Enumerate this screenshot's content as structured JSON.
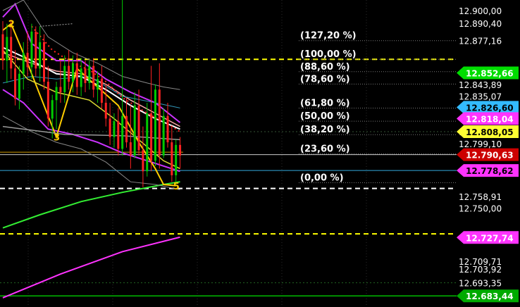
{
  "chart_data": {
    "type": "line",
    "title": "",
    "xlabel": "",
    "ylabel": "",
    "ylim": [
      12675.0,
      12908.0
    ],
    "axis_ticks": [
      {
        "label": "12.900,00",
        "value": 12900.0
      },
      {
        "label": "12.890,40",
        "value": 12890.4
      },
      {
        "label": "12.877,16",
        "value": 12877.16
      },
      {
        "label": "12.843,89",
        "value": 12843.89
      },
      {
        "label": "12.835,07",
        "value": 12835.07
      },
      {
        "label": "12.808,05",
        "value": 12808.05
      },
      {
        "label": "12.799,10",
        "value": 12799.1
      },
      {
        "label": "12.758,91",
        "value": 12758.91
      },
      {
        "label": "12.750,00",
        "value": 12750.0
      },
      {
        "label": "12.709,71",
        "value": 12709.71
      },
      {
        "label": "12.703,92",
        "value": 12703.92
      },
      {
        "label": "12.693,35",
        "value": 12693.35
      }
    ],
    "price_tags": [
      {
        "label": "12.852,66",
        "value": 12852.66,
        "bg": "#00dd00",
        "fg": "#ffffff"
      },
      {
        "label": "12.826,60",
        "value": 12826.6,
        "bg": "#33bbff",
        "fg": "#000000"
      },
      {
        "label": "12.818,04",
        "value": 12818.04,
        "bg": "#ff33ff",
        "fg": "#ffffff"
      },
      {
        "label": "12.808,05",
        "value": 12808.05,
        "bg": "#ffff33",
        "fg": "#000000"
      },
      {
        "label": "12.790,63",
        "value": 12790.63,
        "bg": "#cc0000",
        "fg": "#ffffff"
      },
      {
        "label": "12.778,62",
        "value": 12778.62,
        "bg": "#ff33ff",
        "fg": "#000000"
      },
      {
        "label": "12.727,74",
        "value": 12727.74,
        "bg": "#ff33ff",
        "fg": "#ffffff"
      },
      {
        "label": "12.683,44",
        "value": 12683.44,
        "bg": "#00aa00",
        "fg": "#ffffff"
      }
    ],
    "fib_levels": [
      {
        "label": "(127,20 %)",
        "value": 12877.16
      },
      {
        "label": "(100,00 %)",
        "value": 12863.0
      },
      {
        "label": "(88,60 %)",
        "value": 12853.6
      },
      {
        "label": "(78,60 %)",
        "value": 12844.2
      },
      {
        "label": "(61,80 %)",
        "value": 12826.0
      },
      {
        "label": "(50,00 %)",
        "value": 12816.0
      },
      {
        "label": "(38,20 %)",
        "value": 12805.8
      },
      {
        "label": "(23,60 %)",
        "value": 12791.2
      },
      {
        "label": "(0,00 %)",
        "value": 12769.3
      }
    ],
    "wave_labels": [
      {
        "label": "2",
        "x": 3,
        "y": 12890.0
      },
      {
        "label": "3",
        "x": 14,
        "y": 12804.0
      },
      {
        "label": "5",
        "x": 43,
        "y": 12767.0
      }
    ],
    "colors": {
      "background": "#000000",
      "candle_up": "#00cc00",
      "candle_down": "#ff2222",
      "zigzag": "#ffcc00",
      "envelope": "#cc33ff",
      "dashed_yellow": "#ffff00",
      "dashed_white": "#ffffff",
      "green_ma": "#33ee33",
      "magenta_ma": "#ff33ff"
    },
    "candles": [
      {
        "x": 1,
        "o": 12882,
        "h": 12892,
        "l": 12855,
        "c": 12862
      },
      {
        "x": 2,
        "o": 12862,
        "h": 12890,
        "l": 12845,
        "c": 12880
      },
      {
        "x": 3,
        "o": 12880,
        "h": 12893,
        "l": 12848,
        "c": 12856
      },
      {
        "x": 4,
        "o": 12856,
        "h": 12870,
        "l": 12828,
        "c": 12833
      },
      {
        "x": 5,
        "o": 12833,
        "h": 12858,
        "l": 12825,
        "c": 12852
      },
      {
        "x": 6,
        "o": 12852,
        "h": 12876,
        "l": 12840,
        "c": 12868
      },
      {
        "x": 7,
        "o": 12868,
        "h": 12884,
        "l": 12850,
        "c": 12857
      },
      {
        "x": 8,
        "o": 12857,
        "h": 12890,
        "l": 12848,
        "c": 12884
      },
      {
        "x": 9,
        "o": 12884,
        "h": 12888,
        "l": 12850,
        "c": 12856
      },
      {
        "x": 10,
        "o": 12856,
        "h": 12888,
        "l": 12846,
        "c": 12876
      },
      {
        "x": 11,
        "o": 12876,
        "h": 12882,
        "l": 12840,
        "c": 12846
      },
      {
        "x": 12,
        "o": 12846,
        "h": 12858,
        "l": 12812,
        "c": 12818
      },
      {
        "x": 13,
        "o": 12818,
        "h": 12836,
        "l": 12803,
        "c": 12832
      },
      {
        "x": 14,
        "o": 12832,
        "h": 12846,
        "l": 12810,
        "c": 12842
      },
      {
        "x": 15,
        "o": 12842,
        "h": 12862,
        "l": 12830,
        "c": 12838
      },
      {
        "x": 16,
        "o": 12838,
        "h": 12866,
        "l": 12830,
        "c": 12858
      },
      {
        "x": 17,
        "o": 12858,
        "h": 12870,
        "l": 12840,
        "c": 12846
      },
      {
        "x": 18,
        "o": 12846,
        "h": 12866,
        "l": 12838,
        "c": 12860
      },
      {
        "x": 19,
        "o": 12860,
        "h": 12868,
        "l": 12836,
        "c": 12842
      },
      {
        "x": 20,
        "o": 12842,
        "h": 12864,
        "l": 12835,
        "c": 12856
      },
      {
        "x": 21,
        "o": 12856,
        "h": 12862,
        "l": 12838,
        "c": 12845
      },
      {
        "x": 22,
        "o": 12845,
        "h": 12862,
        "l": 12840,
        "c": 12858
      },
      {
        "x": 23,
        "o": 12858,
        "h": 12864,
        "l": 12834,
        "c": 12840
      },
      {
        "x": 24,
        "o": 12840,
        "h": 12854,
        "l": 12830,
        "c": 12848
      },
      {
        "x": 25,
        "o": 12848,
        "h": 12858,
        "l": 12825,
        "c": 12830
      },
      {
        "x": 26,
        "o": 12830,
        "h": 12844,
        "l": 12812,
        "c": 12818
      },
      {
        "x": 27,
        "o": 12818,
        "h": 12830,
        "l": 12798,
        "c": 12804
      },
      {
        "x": 28,
        "o": 12804,
        "h": 12822,
        "l": 12796,
        "c": 12816
      },
      {
        "x": 29,
        "o": 12816,
        "h": 12826,
        "l": 12790,
        "c": 12795
      },
      {
        "x": 30,
        "o": 12795,
        "h": 12908,
        "l": 12790,
        "c": 12820
      },
      {
        "x": 31,
        "o": 12820,
        "h": 12834,
        "l": 12796,
        "c": 12800
      },
      {
        "x": 32,
        "o": 12800,
        "h": 12828,
        "l": 12780,
        "c": 12790
      },
      {
        "x": 33,
        "o": 12790,
        "h": 12838,
        "l": 12788,
        "c": 12828
      },
      {
        "x": 34,
        "o": 12828,
        "h": 12840,
        "l": 12790,
        "c": 12794
      },
      {
        "x": 35,
        "o": 12794,
        "h": 12812,
        "l": 12766,
        "c": 12778
      },
      {
        "x": 36,
        "o": 12778,
        "h": 12830,
        "l": 12774,
        "c": 12822
      },
      {
        "x": 37,
        "o": 12822,
        "h": 12858,
        "l": 12778,
        "c": 12786
      },
      {
        "x": 38,
        "o": 12786,
        "h": 12844,
        "l": 12782,
        "c": 12840
      },
      {
        "x": 39,
        "o": 12840,
        "h": 12860,
        "l": 12780,
        "c": 12790
      },
      {
        "x": 40,
        "o": 12790,
        "h": 12826,
        "l": 12788,
        "c": 12820
      },
      {
        "x": 41,
        "o": 12820,
        "h": 12830,
        "l": 12796,
        "c": 12800
      },
      {
        "x": 42,
        "o": 12800,
        "h": 12812,
        "l": 12770,
        "c": 12775
      },
      {
        "x": 43,
        "o": 12775,
        "h": 12802,
        "l": 12768,
        "c": 12798
      },
      {
        "x": 44,
        "o": 12798,
        "h": 12804,
        "l": 12780,
        "c": 12790
      }
    ]
  }
}
